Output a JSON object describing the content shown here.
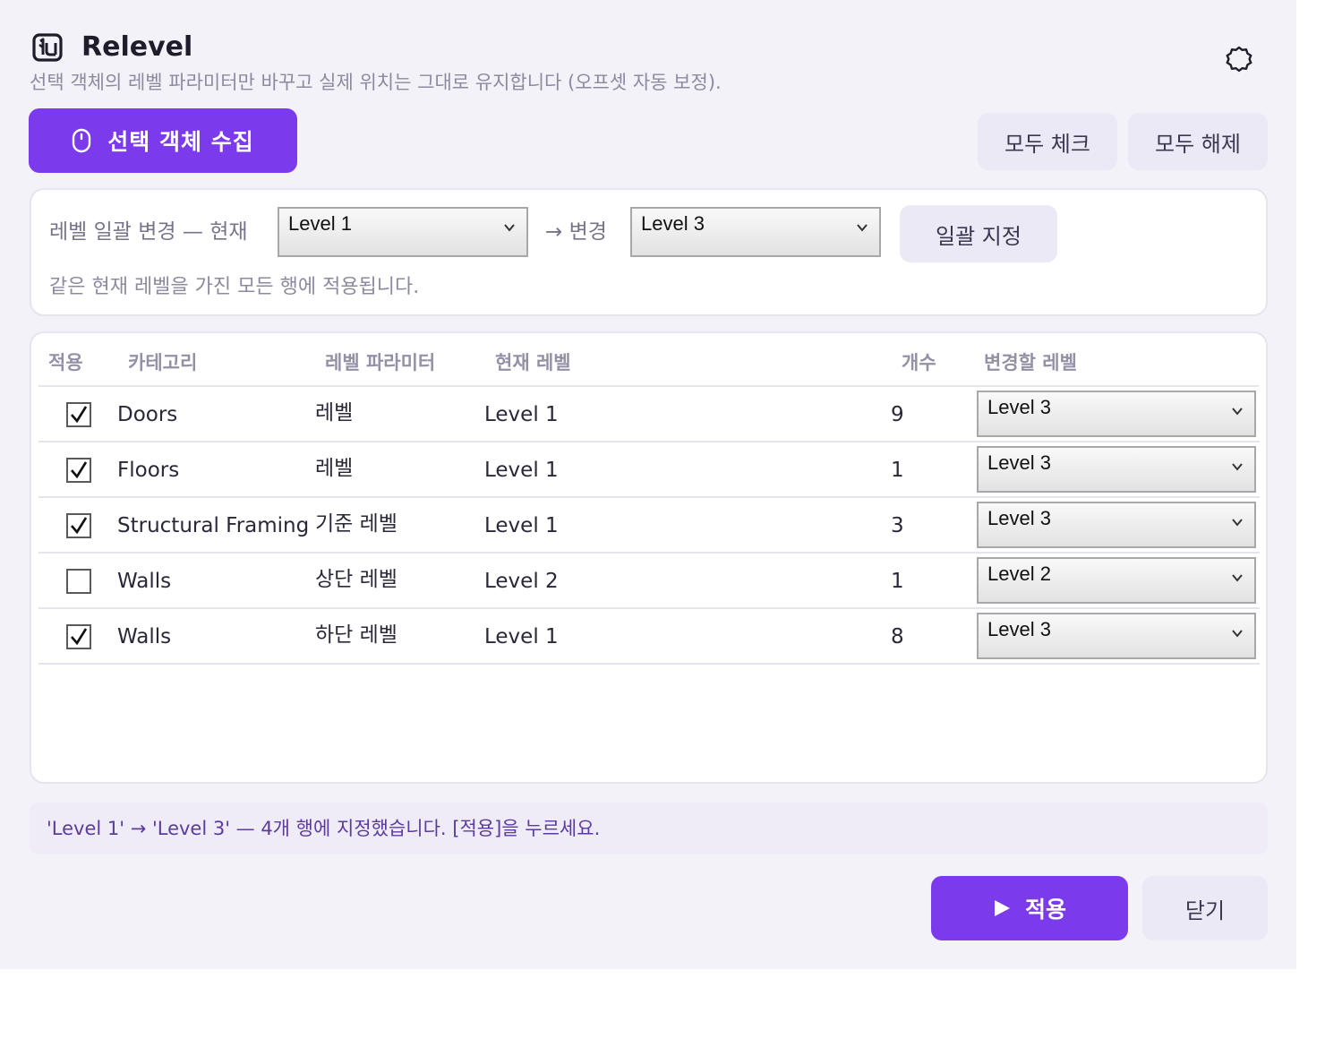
{
  "header": {
    "title": "Relevel",
    "subtitle": "선택 객체의 레벨 파라미터만 바꾸고 실제 위치는 그대로 유지합니다 (오프셋 자동 보정).",
    "logo_icon": "relevel-logo-icon",
    "theme_icon": "theme-toggle-icon"
  },
  "toolbar": {
    "collect_label": "선택 객체 수집",
    "collect_icon": "mouse-icon",
    "check_all_label": "모두 체크",
    "uncheck_all_label": "모두 해제"
  },
  "bulk": {
    "label_prefix": "레벨 일괄 변경 —  현재",
    "current_value": "Level 1",
    "arrow_label": "→  변경",
    "target_value": "Level 3",
    "assign_label": "일괄 지정",
    "note": "같은 현재 레벨을 가진 모든 행에 적용됩니다."
  },
  "table": {
    "columns": [
      "적용",
      "카테고리",
      "레벨 파라미터",
      "현재 레벨",
      "개수",
      "변경할 레벨"
    ],
    "rows": [
      {
        "checked": true,
        "category": "Doors",
        "param": "레벨",
        "current": "Level 1",
        "count": "9",
        "target": "Level 3"
      },
      {
        "checked": true,
        "category": "Floors",
        "param": "레벨",
        "current": "Level 1",
        "count": "1",
        "target": "Level 3"
      },
      {
        "checked": true,
        "category": "Structural Framing",
        "param": "기준 레벨",
        "current": "Level 1",
        "count": "3",
        "target": "Level 3"
      },
      {
        "checked": false,
        "category": "Walls",
        "param": "상단 레벨",
        "current": "Level 2",
        "count": "1",
        "target": "Level 2"
      },
      {
        "checked": true,
        "category": "Walls",
        "param": "하단 레벨",
        "current": "Level 1",
        "count": "8",
        "target": "Level 3"
      }
    ]
  },
  "status": {
    "message": "'Level 1' → 'Level 3' — 4개 행에 지정했습니다. [적용]을 누르세요."
  },
  "footer": {
    "apply_label": "적용",
    "apply_icon": "play-icon",
    "close_label": "닫기"
  },
  "colors": {
    "accent": "#7c3aed",
    "panel_bg": "#f3f2f8",
    "soft_button": "#ebe9f5",
    "status_text": "#5b3b9e"
  }
}
